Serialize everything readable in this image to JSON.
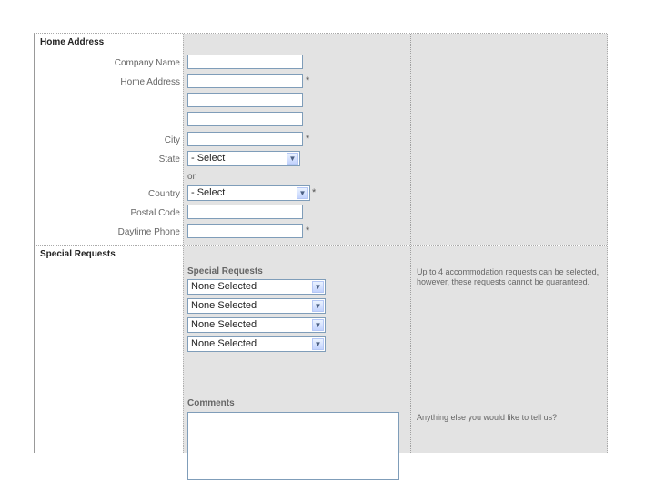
{
  "home_address": {
    "section_title": "Home Address",
    "fields": {
      "company_name": "Company Name",
      "home_address": "Home Address",
      "city": "City",
      "state": "State",
      "country": "Country",
      "postal_code": "Postal Code",
      "daytime_phone": "Daytime Phone"
    },
    "required_marker": "*",
    "state_select": "- Select",
    "or_text": "or",
    "country_select": "- Select"
  },
  "special_requests": {
    "section_title": "Special Requests",
    "subheading": "Special Requests",
    "selects": [
      "None Selected",
      "None Selected",
      "None Selected",
      "None Selected"
    ],
    "help_text": "Up to 4 accommodation requests can be selected, however, these requests cannot be guaranteed.",
    "comments_label": "Comments",
    "comments_help": "Anything else you would like to tell us?"
  }
}
